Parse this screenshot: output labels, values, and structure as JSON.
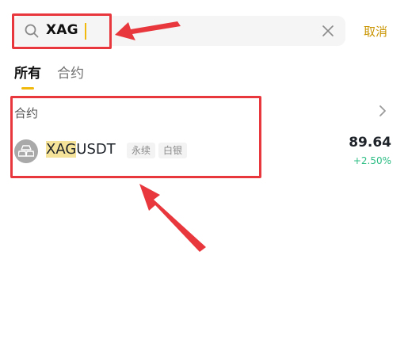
{
  "search": {
    "value_highlight": "XAG",
    "clear_icon": "close-icon",
    "search_icon": "search-icon"
  },
  "header": {
    "cancel_label": "取消"
  },
  "tabs": [
    {
      "label": "所有",
      "active": true
    },
    {
      "label": "合约",
      "active": false
    }
  ],
  "section": {
    "title": "合约"
  },
  "results": [
    {
      "symbol_highlight": "XAG",
      "symbol_rest": "USDT",
      "tags": [
        "永续",
        "白银"
      ],
      "price": "89.64",
      "change": "+2.50%",
      "icon": "silver-bars-icon"
    }
  ],
  "colors": {
    "accent": "#f0b90b",
    "cancel": "#c99400",
    "positive": "#2ebd85",
    "annotation": "#e8383d",
    "highlight": "#f6e39a"
  }
}
